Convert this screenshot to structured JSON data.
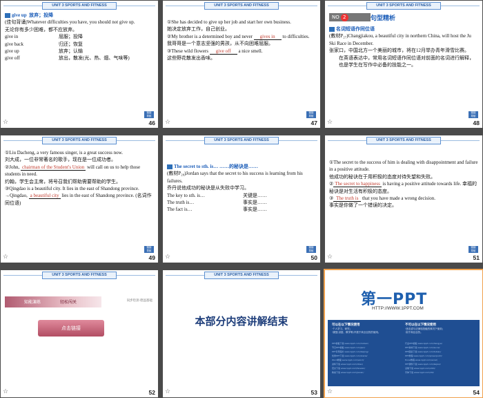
{
  "header_text": "UNIT 3   SPORTS AND FITNESS",
  "star_glyph": "☆",
  "corner_label": "链接\n导航",
  "slides": {
    "s46": {
      "number": "46",
      "lines": {
        "l1a": "give up",
        "l1b": "放弃；投降",
        "l2": "(佳句背诵)Whatever difficulties you have, you should not give up.",
        "l3": "无论你有多少困难，都不应放弃。",
        "r1": [
          "give in",
          "屈服；投降"
        ],
        "r2": [
          "give back",
          "归还；恢复"
        ],
        "r3": [
          "give up",
          "放弃；认输"
        ],
        "r4": [
          "give off",
          "放出，散发(光、热、烟、气味等)"
        ]
      }
    },
    "s47": {
      "number": "47",
      "l1": "①She has decided to give up her job and start her own business.",
      "l2": "她决定放弃工作，自己创业。",
      "l3a": "②My brother is a determined boy and never",
      "l3b": "gives in",
      "l3c": "to difficulties.",
      "l4": "我哥哥是一个意志坚强的男孩，从不向困难屈服。",
      "l5a": "③These wild flowers",
      "l5b": "give off",
      "l5c": "a nice smell.",
      "l6": "这些野花散发出香味。"
    },
    "s48": {
      "number": "48",
      "tag_label": "NO",
      "tag_num": "2",
      "title": "句型精析",
      "sub": "名词短语作同位语",
      "p1": "(教材P₂₇)Changjiakou, a beautiful city in northern China, will host the Ju Ski Race in December.",
      "p2": "张家口，中国北方一个美丽的城市，将在12月举办青年滑雪比赛。",
      "p3": "在英语表达中，常用名词短语作同位语对前面的名词进行解释，也是学生在写作中必备的技能之一。"
    },
    "s49": {
      "number": "49",
      "l1": "①Liu Dacheng, a very famous singer, is a great success now.",
      "l2": "刘大成，一位非常著名的歌手，现在是一位成功者。",
      "l3a": "②John,",
      "l3b": "chairman of the Student's Union",
      "l3c": "will call on us to help those students in need.",
      "l4": "约翰，学生会主席，将号召我们帮助需要帮助的学生。",
      "l5": "③Qingdao is a beautiful city. It lies in the east of Shandong province.",
      "l6a": "→Qingdao,",
      "l6b": "a beautiful city",
      "l6c": "lies in the east of Shandong province. (名词作同位语)"
    },
    "s50": {
      "number": "50",
      "title": "The secret to sth. is… ……的秘诀是……",
      "p1": "(教材P₂₈)Jordan says that the secret to his success is learning from his failures.",
      "p2": "乔丹说他成功的秘诀是从失败中学习。",
      "rows": [
        [
          "The key to sth. is…",
          "关键是……"
        ],
        [
          "The truth is…",
          "事实是……"
        ],
        [
          "The fact is…",
          "事实是……"
        ]
      ]
    },
    "s51": {
      "number": "51",
      "l1": "①The secret to the success of him is dealing with disappointment and failure in a positive attitude.",
      "l2": "他成功的秘诀在于用积极的态度对待失望和失败。",
      "l3a": "②",
      "l3b": "The secret to happiness",
      "l3c": "is having a positive attitude towards life.",
      "l3d": "幸福的秘诀是对生活有积极的态度。",
      "l4a": "③",
      "l4b": "The truth is",
      "l4c": "that you have made a wrong decision.",
      "l5": "事实是你做了一个错误的决定。"
    },
    "s52": {
      "number": "52",
      "band1": "知能演练",
      "band2": "轻松闯关",
      "right": "同步检测·稳固基础",
      "button": "点击链接"
    },
    "s53": {
      "number": "53",
      "text": "本部分内容讲解结束"
    },
    "s54": {
      "number": "54",
      "logo": "第一PPT",
      "url": "HTTP://WWW.1PPT.COM",
      "left_head": "可以在以下情况使用",
      "right_head": "不可以在以下情况使用",
      "left_items": [
        "·个人学习、研究；",
        "·课堂(讲座、教学等)不属于商业目的的使用。"
      ],
      "right_items": [
        "·违法或与法律相抵触的情况下使用；",
        "·用于商业目的。"
      ],
      "left_links": [
        "PPT模板下载  www.1ppt.com/moban/",
        "节日PPT模板  www.1ppt.com/jieri/",
        "PPT背景图片  www.1ppt.com/beijing/",
        "优秀PPT下载  www.1ppt.com/xiazai/",
        "Word教程    www.1ppt.com/word/",
        "资料下载    www.1ppt.com/ziliao/",
        "范文下载    www.1ppt.com/fanwen/",
        "教案下载    www.1ppt.com/jiaoan/"
      ],
      "right_links": [
        "行业PPT模板  www.1ppt.com/hangye/",
        "PPT素材下载  www.1ppt.com/sucai/",
        "PPT图表下载  www.1ppt.com/tubiao/",
        "PPT教程    www.1ppt.com/powerpoint/",
        "Excel教程   www.1ppt.com/excel/",
        "PPT课件下载  www.1ppt.com/kejian/",
        "试卷下载    www.1ppt.com/shiti/",
        "字体下载    www.1ppt.com/ziti/"
      ]
    }
  }
}
